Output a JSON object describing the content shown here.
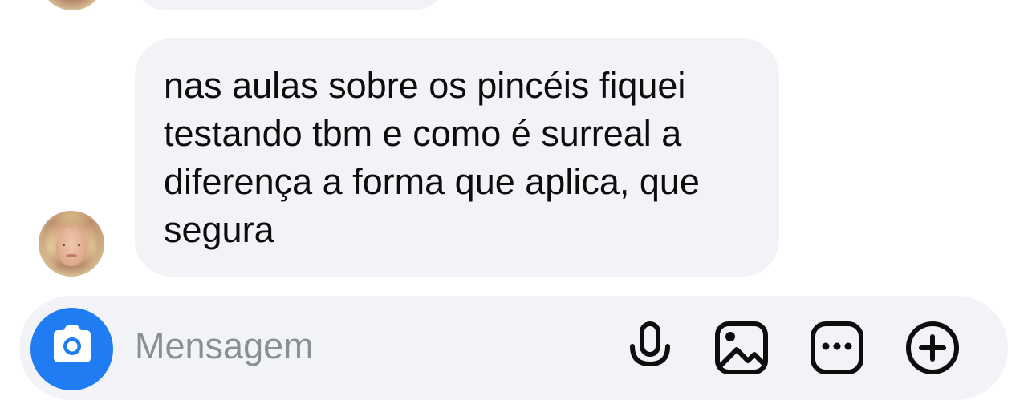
{
  "thread": {
    "previous_message": {
      "sender_avatar_icon": "profile-photo-icon"
    },
    "message": {
      "text": "nas aulas sobre os pincéis fiquei\ntestando tbm e como é surreal a\ndiferença a forma que aplica, que\nsegura",
      "sender_avatar_icon": "profile-photo-icon"
    }
  },
  "composer": {
    "placeholder": "Mensagem",
    "camera_icon": "camera-icon",
    "tools": [
      {
        "icon": "microphone-icon"
      },
      {
        "icon": "image-icon"
      },
      {
        "icon": "sticker-icon"
      },
      {
        "icon": "plus-circle-icon"
      }
    ]
  },
  "colors": {
    "bubble_background": "#f2f3f6",
    "composer_background": "#f2f3f6",
    "camera_button": "#1f7cf2",
    "message_text": "#0d0d0d",
    "placeholder_text": "#8c8e95"
  }
}
